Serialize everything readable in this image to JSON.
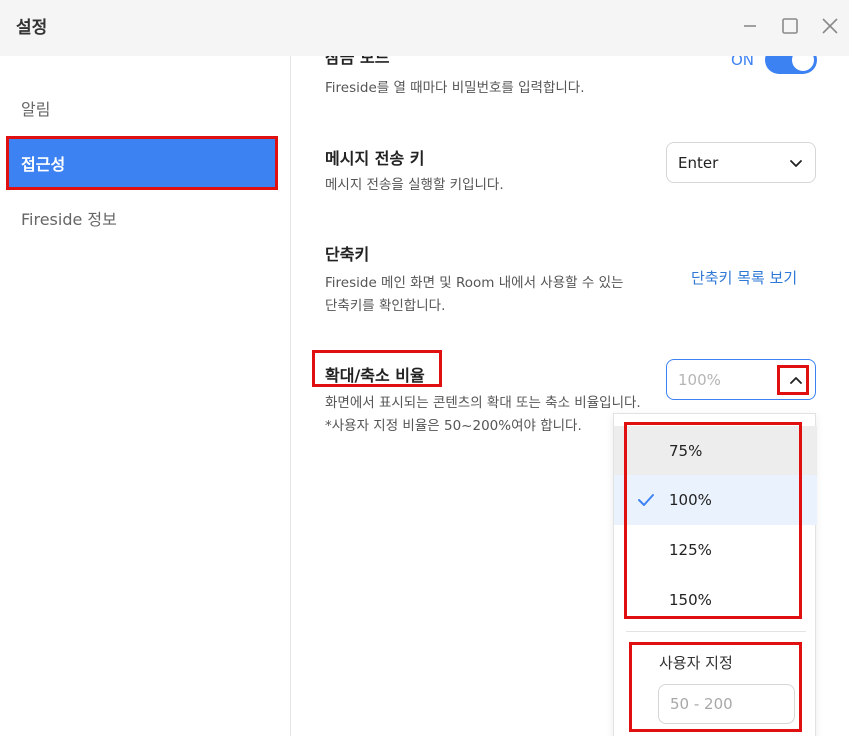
{
  "window": {
    "title": "설정",
    "minimize_icon": "minimize-icon",
    "maximize_icon": "maximize-icon",
    "close_icon": "close-icon"
  },
  "sidebar": {
    "items": [
      {
        "label": "알림",
        "active": false
      },
      {
        "label": "접근성",
        "active": true
      },
      {
        "label": "Fireside 정보",
        "active": false
      }
    ]
  },
  "settings": {
    "password_mode": {
      "title": "잠금 모드",
      "description": "Fireside를 열 때마다 비밀번호를 입력합니다.",
      "toggle_label": "ON",
      "toggle_on": true
    },
    "send_key": {
      "title": "메시지 전송 키",
      "description": "메시지 전송을 실행할 키입니다.",
      "value": "Enter"
    },
    "shortcuts": {
      "title": "단축키",
      "description_line1": "Fireside 메인 화면 및 Room 내에서 사용할 수 있는",
      "description_line2": "단축키를 확인합니다.",
      "link": "단축키 목록 보기"
    },
    "zoom": {
      "title": "확대/축소 비율",
      "description_line1": "화면에서 표시되는 콘텐츠의 확대 또는 축소 비율입니다.",
      "description_line2": "*사용자 지정 비율은 50~200%여야 합니다.",
      "value": "100%",
      "options": [
        "75%",
        "100%",
        "125%",
        "150%"
      ],
      "selected_option": "100%",
      "custom_label": "사용자 지정",
      "custom_placeholder": "50 - 200"
    }
  },
  "colors": {
    "accent": "#3d82f2",
    "highlight_box": "#e01010",
    "link": "#2f79d6"
  }
}
